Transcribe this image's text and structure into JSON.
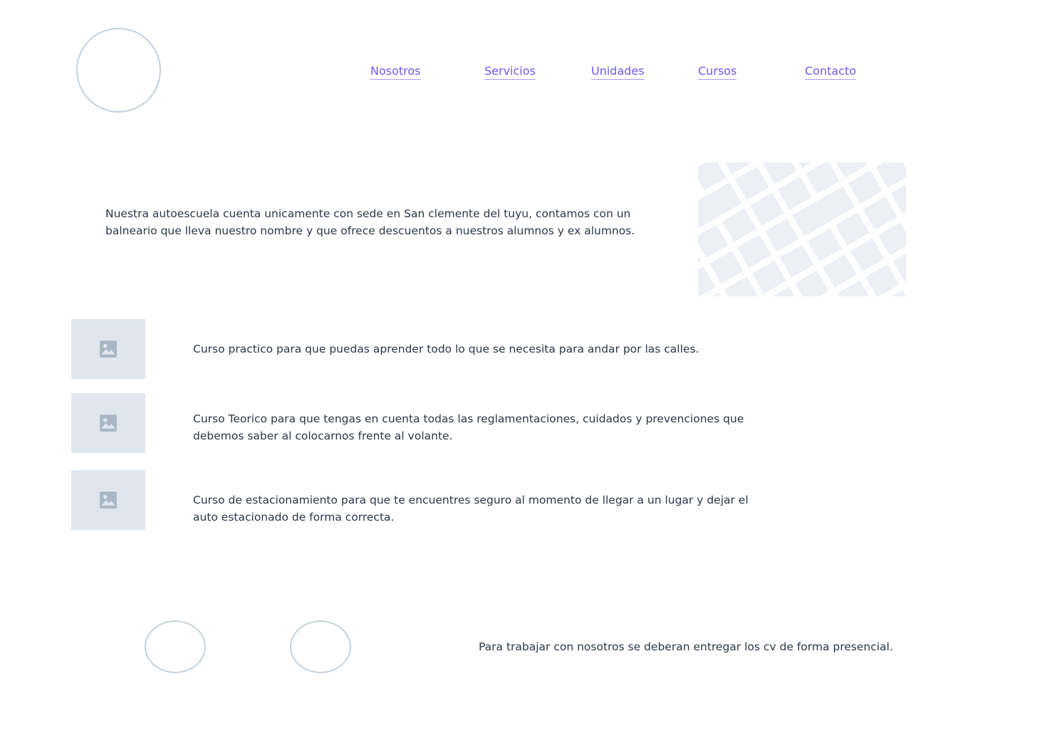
{
  "header": {
    "logo_icon": "logo-placeholder-circle",
    "nav": [
      {
        "label": "Nosotros"
      },
      {
        "label": "Servicios"
      },
      {
        "label": "Unidades"
      },
      {
        "label": "Cursos"
      },
      {
        "label": "Contacto"
      }
    ]
  },
  "about": {
    "text": "Nuestra autoescuela cuenta unicamente con sede en San clemente del tuyu, contamos con un balneario que lleva nuestro nombre y que ofrece descuentos a nuestros alumnos y ex alumnos.",
    "map_icon": "map-placeholder"
  },
  "courses": [
    {
      "icon": "image-placeholder-icon",
      "text": "Curso practico para que puedas aprender todo lo que se necesita para  andar por las calles."
    },
    {
      "icon": "image-placeholder-icon",
      "text": "Curso Teorico para que tengas en cuenta todas las reglamentaciones, cuidados y prevenciones que debemos saber al colocarnos frente al volante."
    },
    {
      "icon": "image-placeholder-icon",
      "text": "Curso de estacionamiento para que te encuentres seguro al momento de llegar a un lugar y dejar el auto estacionado de forma correcta."
    }
  ],
  "footer": {
    "social_icons": [
      "social-placeholder-circle",
      "social-placeholder-circle"
    ],
    "text": "Para trabajar con nosotros se deberan entregar los cv de forma presencial."
  },
  "colors": {
    "link": "#6b5be6",
    "text": "#2d3748",
    "placeholder_bg": "#dfe6ee",
    "placeholder_stroke": "#c5d1dc"
  }
}
